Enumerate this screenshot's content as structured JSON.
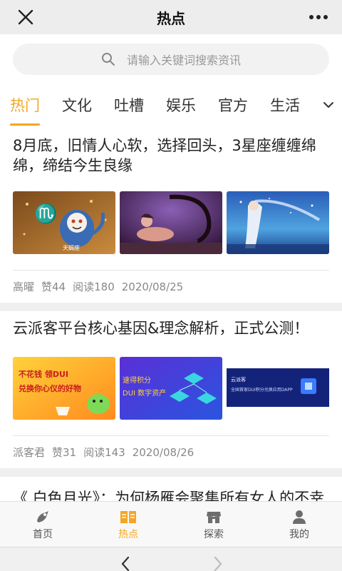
{
  "header": {
    "title": "热点"
  },
  "search": {
    "placeholder": "请输入关键词搜索资讯"
  },
  "tabs": [
    {
      "label": "热门",
      "active": true
    },
    {
      "label": "文化"
    },
    {
      "label": "吐槽"
    },
    {
      "label": "娱乐"
    },
    {
      "label": "官方"
    },
    {
      "label": "生活"
    }
  ],
  "articles": [
    {
      "title": "8月底，旧情人心软，选择回头，3星座缠缠绵绵，缔结今生良缘",
      "author": "高曜",
      "likes": "赞44",
      "reads": "阅读180",
      "date": "2020/08/25",
      "thumb1_text": "天蝎座"
    },
    {
      "title": "云派客平台核心基因&理念解析，正式公测！",
      "author": "派客君",
      "likes": "赞31",
      "reads": "阅读143",
      "date": "2020/08/26",
      "thumb1_text_a": "不花钱 领DUI",
      "thumb1_text_b": "兑换你心仪的好物",
      "thumb2_text_a": "速得积分",
      "thumb2_text_b": "DUI 数字资产",
      "thumb3_text_a": "云派客",
      "thumb3_text_b": "全国首家DUI积分兑换应用DAPP"
    },
    {
      "title": "《 白色月光》：为何杨雁会聚集所有女人的不幸"
    }
  ],
  "bottom_nav": [
    {
      "label": "首页"
    },
    {
      "label": "热点",
      "active": true
    },
    {
      "label": "探索"
    },
    {
      "label": "我的"
    }
  ],
  "colors": {
    "accent": "#f5a623",
    "topbar": "#ededed",
    "search_bg": "#f2f2f2"
  }
}
